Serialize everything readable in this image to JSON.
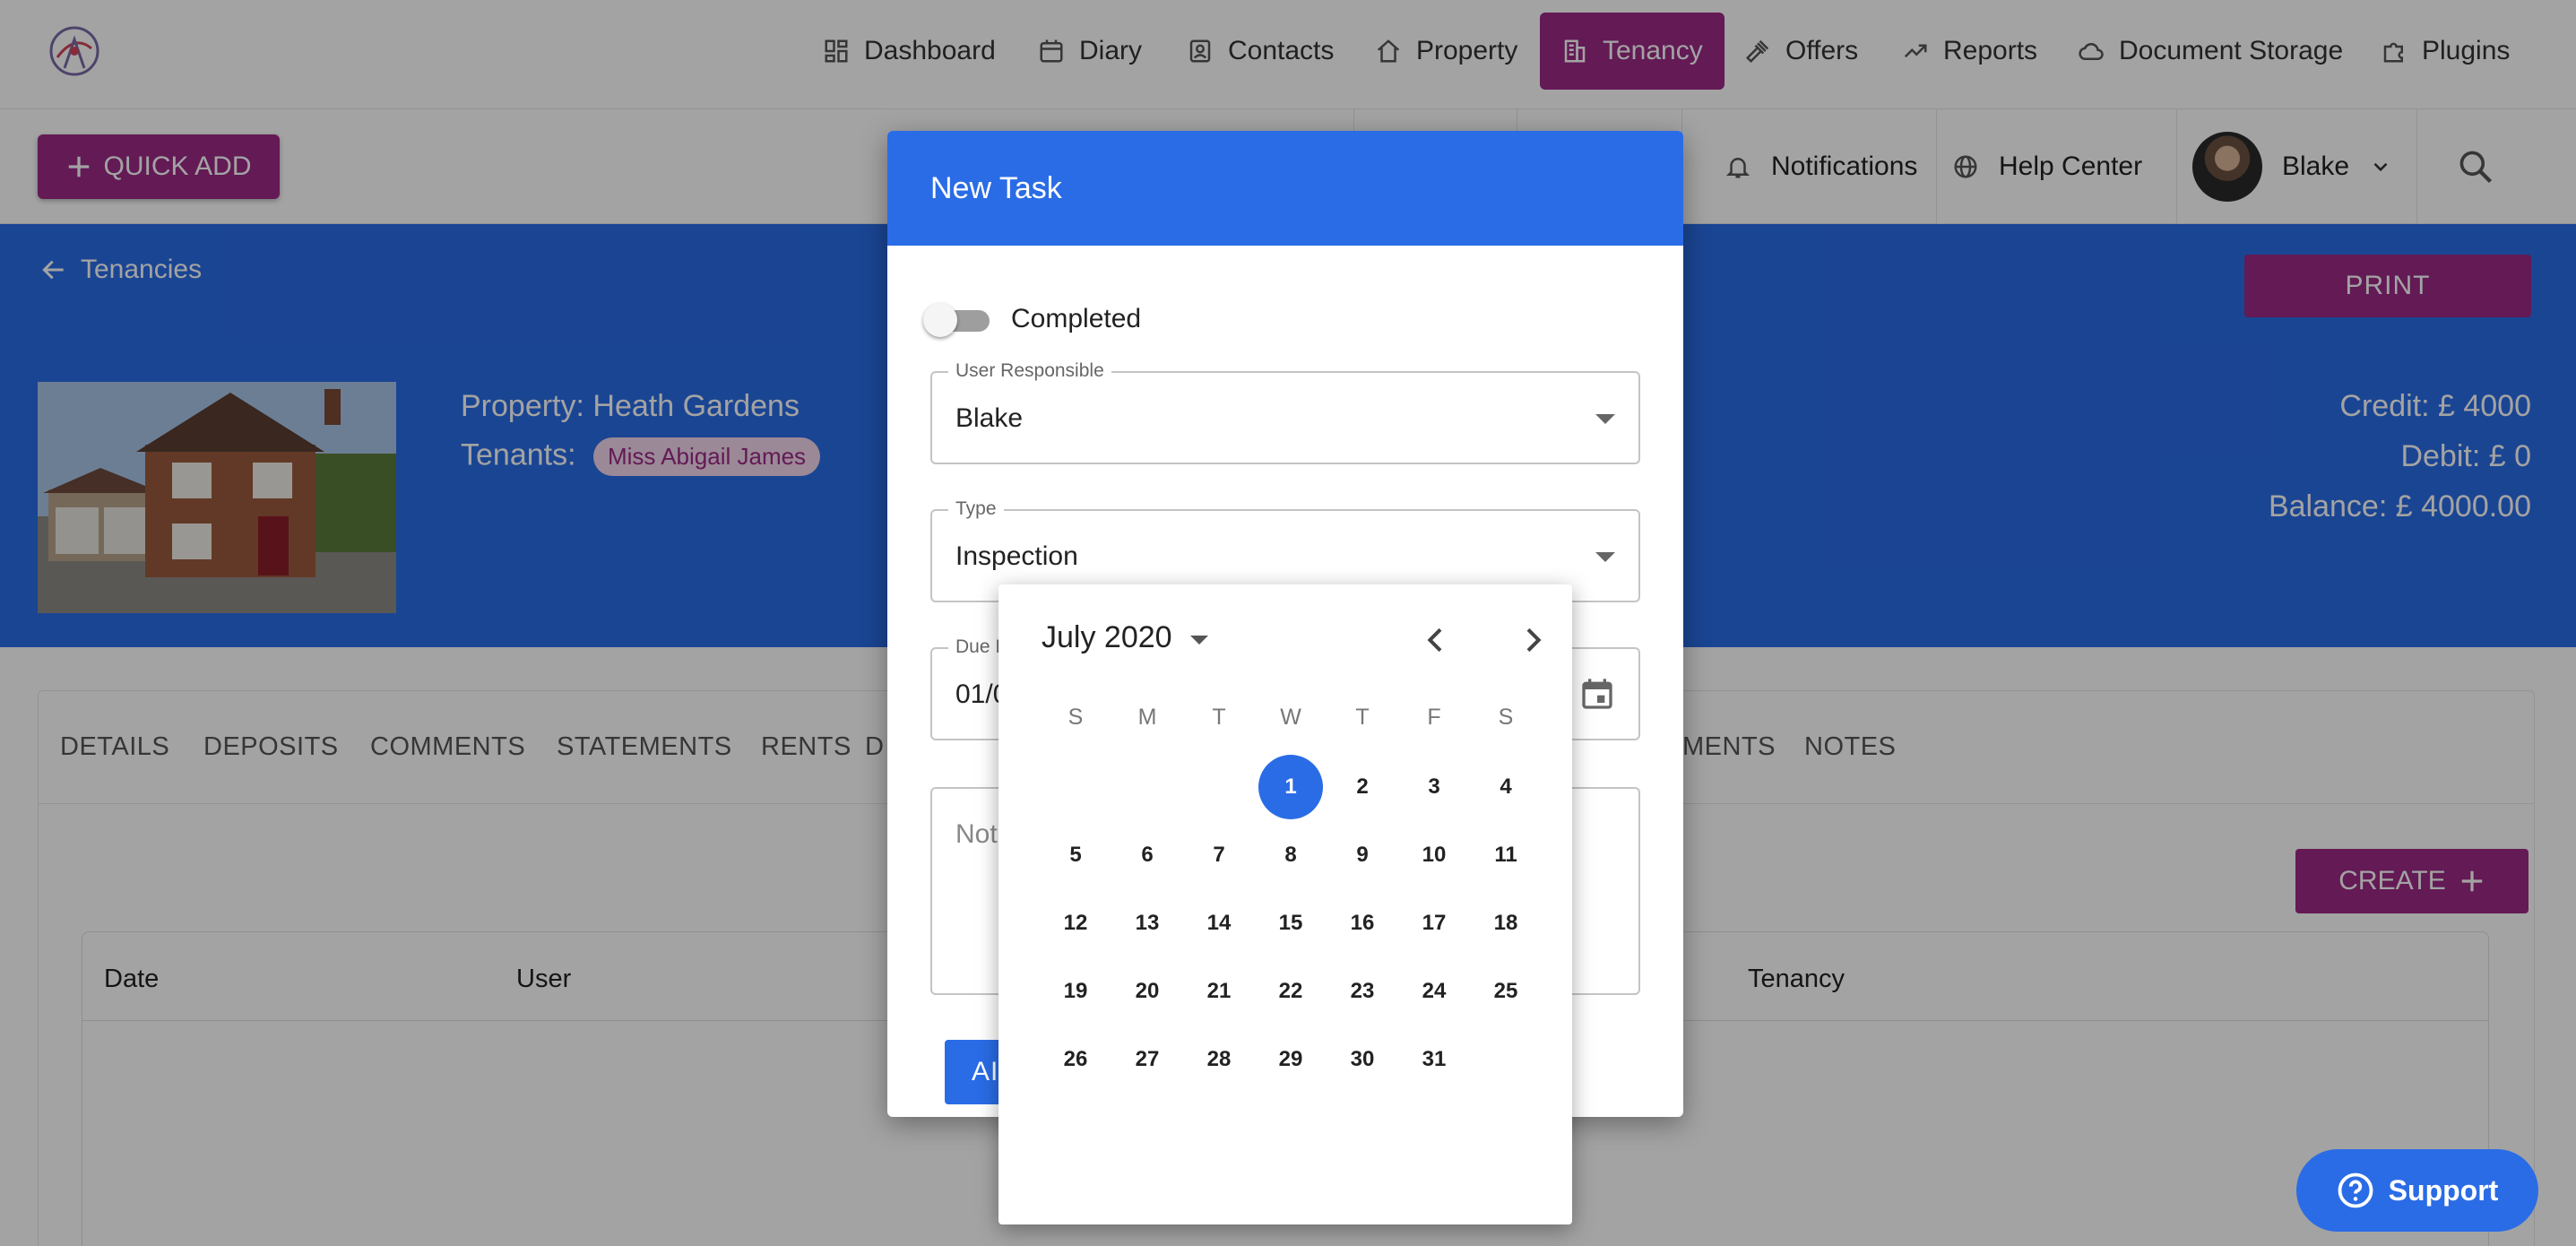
{
  "nav": {
    "items": [
      {
        "label": "Dashboard",
        "icon": "dashboard-icon"
      },
      {
        "label": "Diary",
        "icon": "calendar-icon"
      },
      {
        "label": "Contacts",
        "icon": "contacts-icon"
      },
      {
        "label": "Property",
        "icon": "home-icon"
      },
      {
        "label": "Tenancy",
        "icon": "building-icon"
      },
      {
        "label": "Offers",
        "icon": "gavel-icon"
      },
      {
        "label": "Reports",
        "icon": "trending-up-icon"
      },
      {
        "label": "Document Storage",
        "icon": "cloud-icon"
      },
      {
        "label": "Plugins",
        "icon": "puzzle-icon"
      }
    ],
    "active": "Tenancy"
  },
  "toolbar": {
    "quick_add": "QUICK ADD",
    "notifications": "Notifications",
    "help_center": "Help Center",
    "user_name": "Blake"
  },
  "hero": {
    "back_label": "Tenancies",
    "print_label": "PRINT",
    "property_line": "Property: Heath Gardens",
    "tenants_label": "Tenants:",
    "tenant_name": "Miss Abigail James",
    "credit": "Credit: £ 4000",
    "debit": "Debit: £ 0",
    "balance": "Balance: £ 4000.00"
  },
  "tabs": {
    "details": "DETAILS",
    "deposits": "DEPOSITS",
    "comments": "COMMENTS",
    "statements": "STATEMENTS",
    "rents": "RENTS",
    "partial_left": "D",
    "partial_right": "MENTS",
    "notes": "NOTES"
  },
  "main": {
    "create_label": "CREATE",
    "table_headers": {
      "date": "Date",
      "user": "User",
      "tenancy": "Tenancy"
    }
  },
  "support_label": "Support",
  "dialog": {
    "title": "New Task",
    "completed_label": "Completed",
    "completed": false,
    "user_label": "User Responsible",
    "user_value": "Blake",
    "type_label": "Type",
    "type_value": "Inspection",
    "due_label_visible": "Due I",
    "due_value_visible": "01/0",
    "notes_placeholder_visible": "Not",
    "add_label_visible": "AI"
  },
  "datepicker": {
    "month_label": "July 2020",
    "weekdays": [
      "S",
      "M",
      "T",
      "W",
      "T",
      "F",
      "S"
    ],
    "first_weekday_index": 3,
    "days_in_month": 31,
    "selected_day": 1
  },
  "colors": {
    "primary_blue": "#2a6ce6",
    "accent_purple": "#9c2a86"
  }
}
